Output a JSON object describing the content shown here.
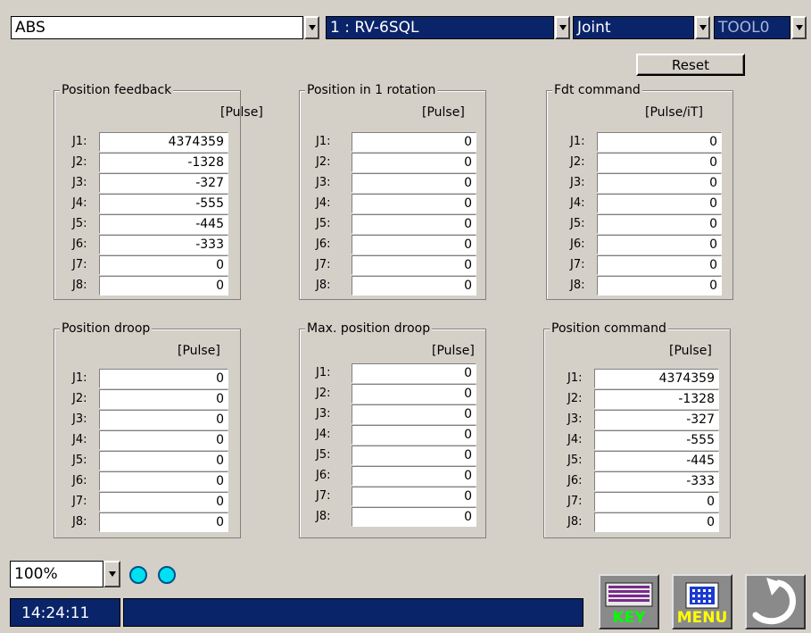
{
  "top": {
    "mode": {
      "value": "ABS"
    },
    "robot": {
      "value": "1 : RV-6SQL"
    },
    "coord": {
      "value": "Joint"
    },
    "tool": {
      "value": "TOOL0"
    }
  },
  "reset_label": "Reset",
  "panels": {
    "position_feedback": {
      "title": "Position feedback",
      "unit": "[Pulse]",
      "labels": [
        "J1:",
        "J2:",
        "J3:",
        "J4:",
        "J5:",
        "J6:",
        "J7:",
        "J8:"
      ],
      "values": [
        "4374359",
        "-1328",
        "-327",
        "-555",
        "-445",
        "-333",
        "0",
        "0"
      ]
    },
    "position_1_rotation": {
      "title": "Position in 1 rotation",
      "unit": "[Pulse]",
      "labels": [
        "J1:",
        "J2:",
        "J3:",
        "J4:",
        "J5:",
        "J6:",
        "J7:",
        "J8:"
      ],
      "values": [
        "0",
        "0",
        "0",
        "0",
        "0",
        "0",
        "0",
        "0"
      ]
    },
    "fdt_command": {
      "title": "Fdt command",
      "unit": "[Pulse/iT]",
      "labels": [
        "J1:",
        "J2:",
        "J3:",
        "J4:",
        "J5:",
        "J6:",
        "J7:",
        "J8:"
      ],
      "values": [
        "0",
        "0",
        "0",
        "0",
        "0",
        "0",
        "0",
        "0"
      ]
    },
    "position_droop": {
      "title": "Position droop",
      "unit": "[Pulse]",
      "labels": [
        "J1:",
        "J2:",
        "J3:",
        "J4:",
        "J5:",
        "J6:",
        "J7:",
        "J8:"
      ],
      "values": [
        "0",
        "0",
        "0",
        "0",
        "0",
        "0",
        "0",
        "0"
      ]
    },
    "max_position_droop": {
      "title": "Max. position droop",
      "unit": "[Pulse]",
      "labels": [
        "J1:",
        "J2:",
        "J3:",
        "J4:",
        "J5:",
        "J6:",
        "J7:",
        "J8:"
      ],
      "values": [
        "0",
        "0",
        "0",
        "0",
        "0",
        "0",
        "0",
        "0"
      ]
    },
    "position_command": {
      "title": "Position command",
      "unit": "[Pulse]",
      "labels": [
        "J1:",
        "J2:",
        "J3:",
        "J4:",
        "J5:",
        "J6:",
        "J7:",
        "J8:"
      ],
      "values": [
        "4374359",
        "-1328",
        "-327",
        "-555",
        "-445",
        "-333",
        "0",
        "0"
      ]
    }
  },
  "bottom": {
    "zoom": "100%",
    "time": "14:24:11",
    "key_label": "KEY",
    "menu_label": "MENU"
  },
  "colors": {
    "accent": "#0a246a",
    "led": "#00e0f0",
    "key_text": "#00ff00",
    "menu_text": "#ffff00"
  }
}
